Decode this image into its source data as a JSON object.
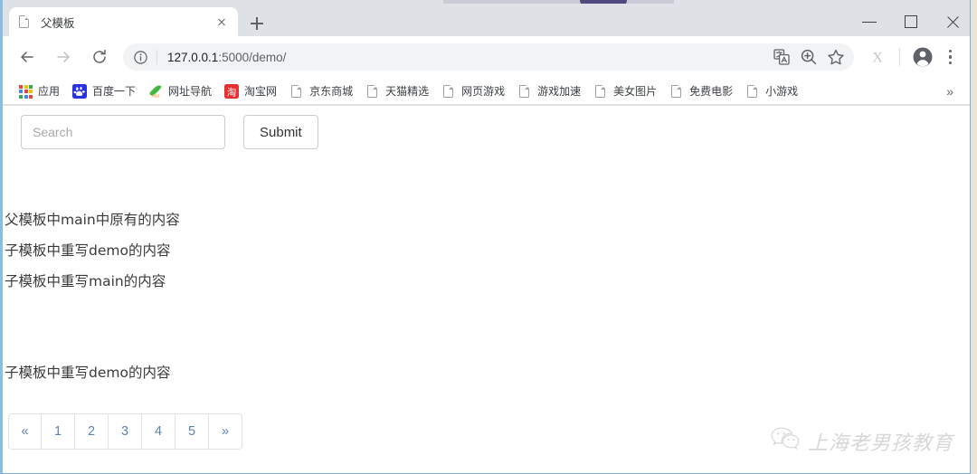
{
  "window": {
    "controls": {
      "minimize": "minimize-button",
      "maximize": "maximize-button",
      "close": "close-button"
    }
  },
  "tabstrip": {
    "tabs": [
      {
        "title": "父模板",
        "favicon": "document-icon",
        "active": true
      }
    ],
    "new_tab_label": "+"
  },
  "toolbar": {
    "back": "back-arrow-icon",
    "forward": "forward-arrow-icon",
    "reload": "reload-icon",
    "site_info": "info-circle-icon",
    "url": {
      "host": "127.0.0.1",
      "path": ":5000/demo/",
      "full": "127.0.0.1:5000/demo/"
    },
    "omnibox_icons": [
      {
        "name": "translate-icon"
      },
      {
        "name": "zoom-search-icon"
      },
      {
        "name": "bookmark-star-icon"
      }
    ],
    "extension_icon": {
      "name": "extension-x-icon",
      "glyph": "X"
    },
    "profile": "profile-avatar-icon",
    "menu": "three-dot-menu-icon"
  },
  "bookmarks": {
    "items": [
      {
        "label": "应用",
        "icon": "apps-grid-icon"
      },
      {
        "label": "百度一下",
        "icon": "baidu-paw-icon"
      },
      {
        "label": "网址导航",
        "icon": "hao123-icon"
      },
      {
        "label": "淘宝网",
        "icon": "taobao-icon"
      },
      {
        "label": "京东商城",
        "icon": "document-icon"
      },
      {
        "label": "天猫精选",
        "icon": "document-icon"
      },
      {
        "label": "网页游戏",
        "icon": "document-icon"
      },
      {
        "label": "游戏加速",
        "icon": "document-icon"
      },
      {
        "label": "美女图片",
        "icon": "document-icon"
      },
      {
        "label": "免费电影",
        "icon": "document-icon"
      },
      {
        "label": "小游戏",
        "icon": "document-icon"
      }
    ],
    "overflow_label": "»"
  },
  "page": {
    "search": {
      "placeholder": "Search",
      "value": "",
      "submit_label": "Submit"
    },
    "content_lines": [
      "父模板中main中原有的内容",
      "子模板中重写demo的内容",
      "子模板中重写main的内容",
      "子模板中重写demo的内容"
    ],
    "pagination": {
      "prev_label": "«",
      "pages": [
        "1",
        "2",
        "3",
        "4",
        "5"
      ],
      "next_label": "»"
    },
    "watermark": {
      "icon": "wechat-icon",
      "text": "上海老男孩教育"
    }
  },
  "colors": {
    "tabstrip_bg": "#dee1e6",
    "toolbar_bg": "#ffffff",
    "omnibox_bg": "#f1f3f4",
    "link_blue": "#5a83b5",
    "window_border": "#8bbde0",
    "desktop": "#e9e5d9",
    "text": "#3a3a3a"
  }
}
